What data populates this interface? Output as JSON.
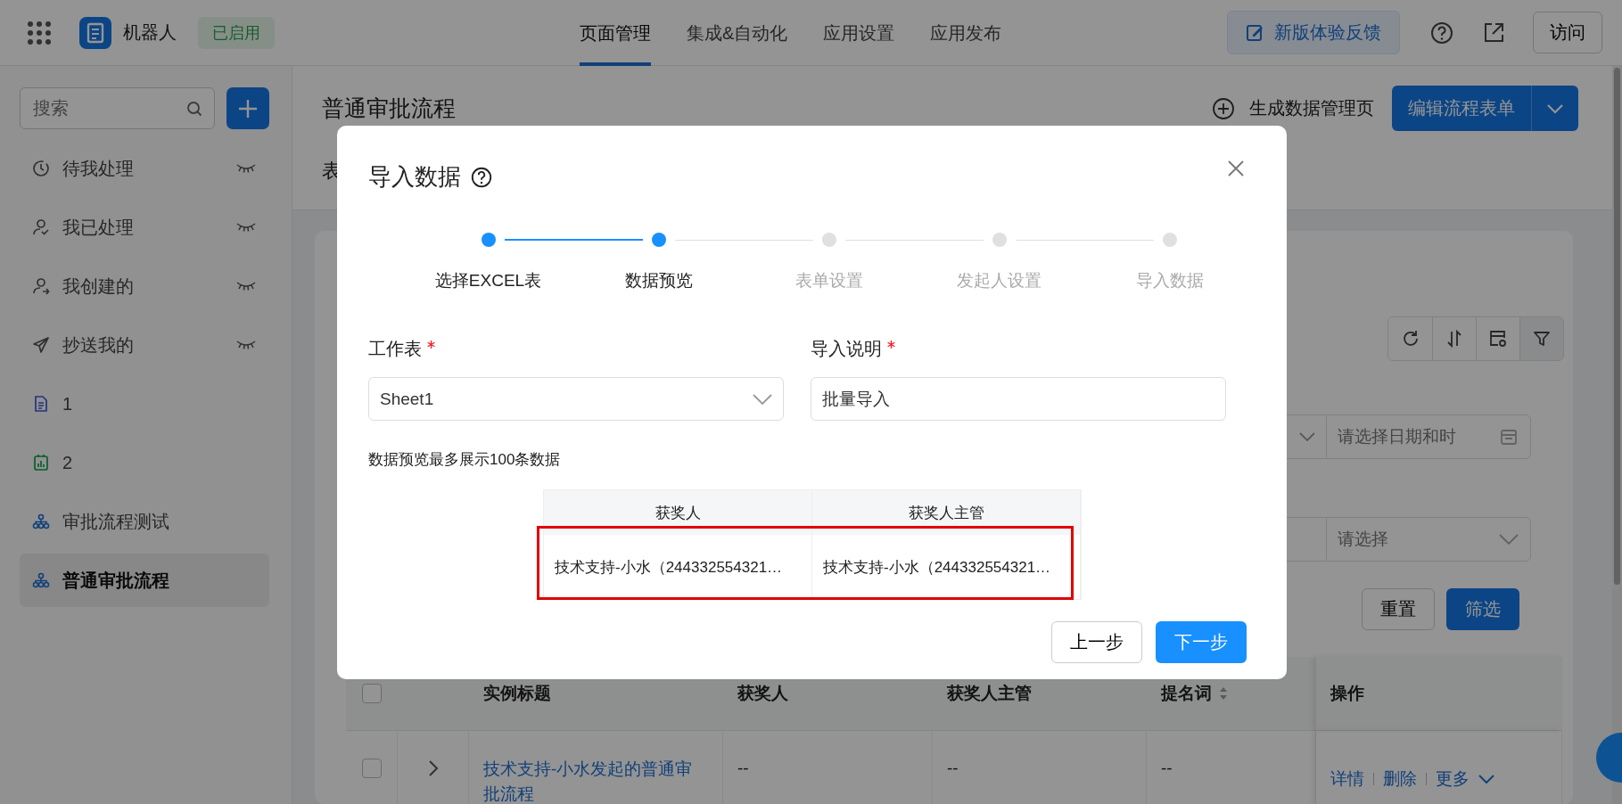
{
  "top_bar": {
    "app_name": "机器人",
    "status_badge": "已启用",
    "nav_tabs": [
      {
        "label": "页面管理",
        "selected": true
      },
      {
        "label": "集成&自动化",
        "selected": false
      },
      {
        "label": "应用设置",
        "selected": false
      },
      {
        "label": "应用发布",
        "selected": false
      }
    ],
    "feedback_button": "新版体验反馈",
    "visit_button": "访问"
  },
  "sidebar": {
    "search": {
      "placeholder": "搜索"
    },
    "items": [
      {
        "label": "待我处理",
        "kind": "todo",
        "hidden": true,
        "selected": false
      },
      {
        "label": "我已处理",
        "kind": "done",
        "hidden": true,
        "selected": false
      },
      {
        "label": "我创建的",
        "kind": "created",
        "hidden": true,
        "selected": false
      },
      {
        "label": "抄送我的",
        "kind": "cc",
        "hidden": true,
        "selected": false
      },
      {
        "label": "1",
        "kind": "form",
        "hidden": false,
        "selected": false
      },
      {
        "label": "2",
        "kind": "report",
        "hidden": false,
        "selected": false
      },
      {
        "label": "审批流程测试",
        "kind": "flow",
        "hidden": false,
        "selected": false
      },
      {
        "label": "普通审批流程",
        "kind": "flow",
        "hidden": false,
        "selected": true
      }
    ]
  },
  "page": {
    "title": "普通审批流程",
    "generate_link": "生成数据管理页",
    "edit_button": "编辑流程表单",
    "tab_partial": "表"
  },
  "filters": {
    "date_field": {
      "placeholder": "请选择日期和时"
    },
    "select_field": {
      "placeholder": "请选择"
    },
    "reset_button": "重置",
    "filter_button": "筛选"
  },
  "table": {
    "select_all_checked": false,
    "columns": [
      {
        "label": "实例标题",
        "sortable": false
      },
      {
        "label": "获奖人",
        "sortable": false
      },
      {
        "label": "获奖人主管",
        "sortable": false
      },
      {
        "label": "提名词",
        "sortable": true
      },
      {
        "label": "操作",
        "sortable": false
      }
    ],
    "rows": [
      {
        "checked": false,
        "cells": [
          "技术支持-小水发起的普通审批流程",
          "--",
          "--",
          "--"
        ],
        "actions": [
          "详情",
          "删除",
          "更多"
        ]
      }
    ]
  },
  "dialog": {
    "title": "导入数据",
    "steps": [
      {
        "label": "选择EXCEL表",
        "active": true
      },
      {
        "label": "数据预览",
        "active": true
      },
      {
        "label": "表单设置",
        "active": false
      },
      {
        "label": "发起人设置",
        "active": false
      },
      {
        "label": "导入数据",
        "active": false
      }
    ],
    "fields": [
      {
        "label": "工作表",
        "required": true,
        "kind": "select",
        "value": "Sheet1"
      },
      {
        "label": "导入说明",
        "required": true,
        "kind": "input",
        "value": "批量导入"
      }
    ],
    "note": "数据预览最多展示100条数据",
    "preview": {
      "columns": [
        "获奖人",
        "获奖人主管"
      ],
      "rows": [
        {
          "cells": [
            "技术支持-小水（244332554321…",
            "技术支持-小水（244332554321…"
          ],
          "highlighted": true
        }
      ]
    },
    "back_button": "上一步",
    "next_button": "下一步"
  }
}
